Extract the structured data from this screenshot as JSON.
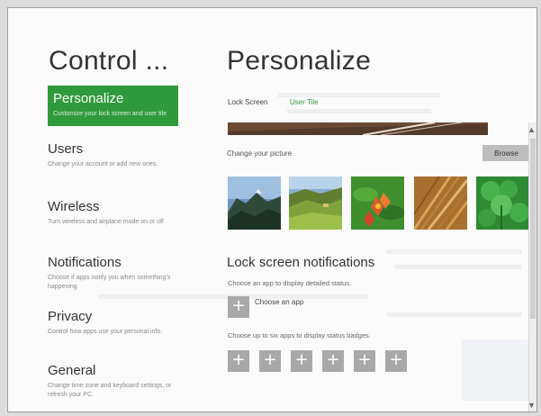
{
  "left_pane": {
    "title": "Control ...",
    "items": [
      {
        "label": "Personalize",
        "desc": "Customize your lock screen and user tile",
        "active": true
      },
      {
        "label": "Users",
        "desc": "Change your account or add new ones."
      },
      {
        "label": "Wireless",
        "desc": "Turn wireless and airplane mode on or off"
      },
      {
        "label": "Notifications",
        "desc": "Choose if apps notify you when something's happening"
      },
      {
        "label": "Privacy",
        "desc": "Control how apps use your personal info."
      },
      {
        "label": "General",
        "desc": "Change time zone and keyboard settings, or refresh your PC."
      }
    ]
  },
  "main": {
    "title": "Personalize",
    "tabs": [
      {
        "label": "Lock Screen"
      },
      {
        "label": "User Tile",
        "active": true
      }
    ],
    "change_picture_label": "Change your picture",
    "browse_label": "Browse",
    "thumbnails": [
      {
        "icon": "mountain-landscape-thumbnail"
      },
      {
        "icon": "green-valley-thumbnail"
      },
      {
        "icon": "flower-thumbnail"
      },
      {
        "icon": "wheat-thumbnail"
      },
      {
        "icon": "clover-thumbnail"
      }
    ],
    "lock_screen_notifications": {
      "title": "Lock screen notifications",
      "detailed_desc": "Choose an app to display detailed status.",
      "choose_app_label": "Choose an app",
      "badges_desc": "Choose up to six apps to display status badges.",
      "plus_symbol": "+"
    }
  },
  "colors": {
    "accent": "#2f9a3c",
    "plus_button": "#a8a8a8"
  }
}
